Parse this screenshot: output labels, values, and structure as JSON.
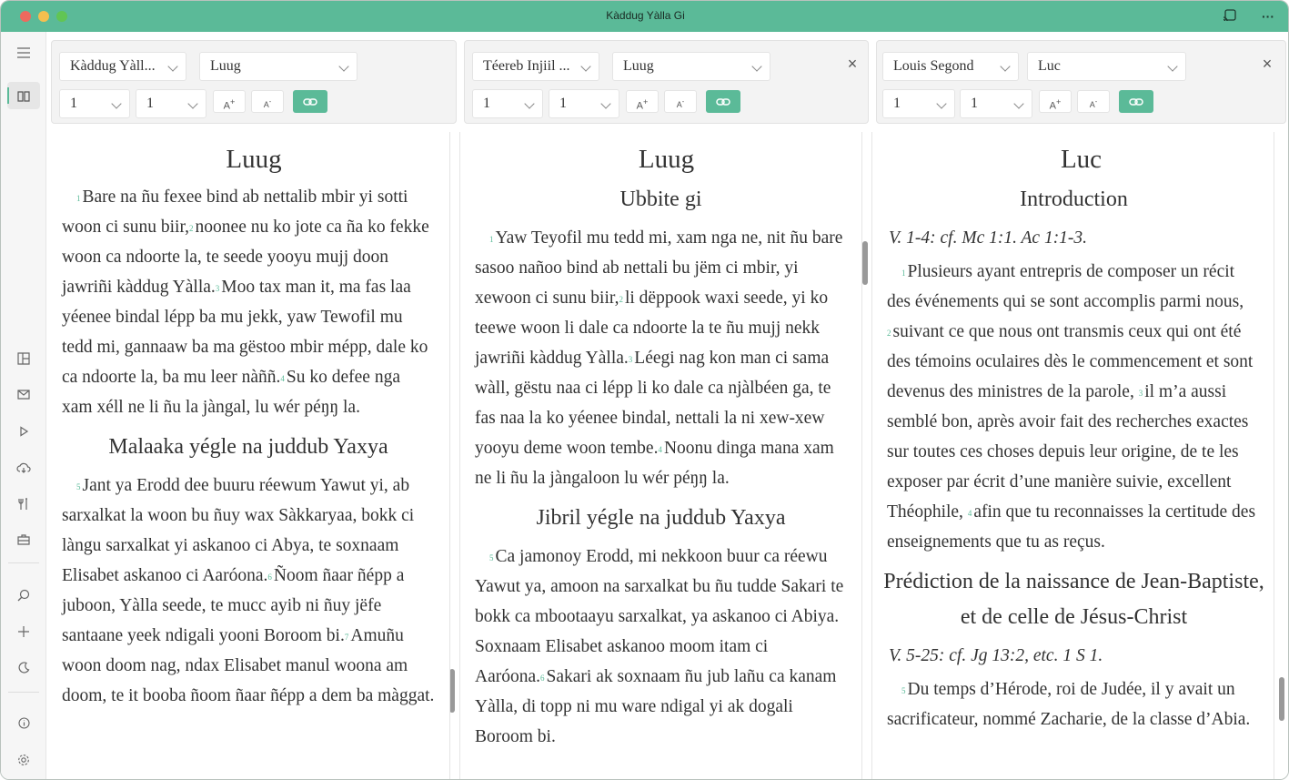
{
  "window": {
    "title": "Kàddug Yàlla Gi"
  },
  "colors": {
    "accent": "#5bba98",
    "titlebar": "#5bba98"
  },
  "sidebar": {
    "items": [
      {
        "name": "menu-icon"
      },
      {
        "name": "book-icon"
      },
      {
        "name": "compare-icon"
      },
      {
        "name": "mail-icon"
      },
      {
        "name": "play-icon"
      },
      {
        "name": "cloud-download-icon"
      },
      {
        "name": "tools-icon"
      },
      {
        "name": "briefcase-icon"
      },
      {
        "name": "search-icon"
      },
      {
        "name": "plus-icon"
      },
      {
        "name": "moon-icon"
      },
      {
        "name": "info-icon"
      },
      {
        "name": "settings-icon"
      }
    ]
  },
  "panes": [
    {
      "version": "Kàddug Yàll...",
      "book": "Luug",
      "chapter": "1",
      "verse": "1",
      "font_up": "A",
      "font_down": "A",
      "closable": false,
      "title": "Luug",
      "blocks": [
        {
          "type": "para",
          "segments": [
            {
              "v": "1",
              "t": "Bare na ñu fexee bind ab nettalib mbir yi sotti woon ci sunu biir,"
            },
            {
              "v": "2",
              "t": "noonee nu ko jote ca ña ko fekke woon ca ndoorte la, te seede yooyu mujj doon jawriñi kàddug Yàlla."
            },
            {
              "v": "3",
              "t": "Moo tax man it, ma fas laa yéenee bindal lépp ba mu jekk, yaw Tewofil mu tedd mi, gannaaw ba ma gëstoo mbir mépp, dale ko ca ndoorte la, ba mu leer nàññ."
            },
            {
              "v": "4",
              "t": "Su ko defee nga xam xéll ne li ñu la jàngal, lu wér péŋŋ la."
            }
          ]
        },
        {
          "type": "heading",
          "text": "Malaaka yégle na juddub Yaxya"
        },
        {
          "type": "para",
          "segments": [
            {
              "v": "5",
              "t": "Jant ya Erodd dee buuru réewum Yawut yi, ab sarxalkat la woon bu ñuy wax Sàkkaryaa, bokk ci làngu sarxalkat yi askanoo ci Abya, te soxnaam Elisabet askanoo ci Aaróona."
            },
            {
              "v": "6",
              "t": "Ñoom ñaar ñépp a juboon, Yàlla seede, te mucc ayib ni ñuy jëfe santaane yeek ndigali yooni Boroom bi."
            },
            {
              "v": "7",
              "t": "Amuñu woon doom nag, ndax Elisabet manul woona am doom, te it booba ñoom ñaar ñépp a dem ba màggat."
            }
          ]
        }
      ]
    },
    {
      "version": "Téereb Injiil ...",
      "book": "Luug",
      "chapter": "1",
      "verse": "1",
      "font_up": "A",
      "font_down": "A",
      "closable": true,
      "title": "Luug",
      "blocks": [
        {
          "type": "heading",
          "text": "Ubbite gi"
        },
        {
          "type": "para",
          "segments": [
            {
              "v": "1",
              "t": "Yaw Teyofil mu tedd mi, xam nga ne, nit ñu bare sasoo nañoo bind ab nettali bu jëm ci mbir, yi xewoon ci sunu biir,"
            },
            {
              "v": "2",
              "t": "li dëppook waxi seede, yi ko teewe woon li dale ca ndoorte la te ñu mujj nekk jawriñi kàddug Yàlla."
            },
            {
              "v": "3",
              "t": "Léegi nag kon man ci sama wàll, gëstu naa ci lépp li ko dale ca njàlbéen ga, te fas naa la ko yéenee bindal, nettali la ni xew-xew yooyu deme woon tembe."
            },
            {
              "v": "4",
              "t": "Noonu dinga mana xam ne li ñu la jàngaloon lu wér péŋŋ la."
            }
          ]
        },
        {
          "type": "heading",
          "text": "Jibril yégle na juddub Yaxya"
        },
        {
          "type": "para",
          "segments": [
            {
              "v": "5",
              "t": "Ca jamonoy Erodd, mi nekkoon buur ca réewu Yawut ya, amoon na sarxalkat bu ñu tudde Sakari te bokk ca mbootaayu sarxalkat, ya askanoo ci Abiya. Soxnaam Elisabet askanoo moom itam ci Aaróona."
            },
            {
              "v": "6",
              "t": "Sakari ak soxnaam ñu jub lañu ca kanam Yàlla, di topp ni mu ware ndigal yi ak dogali Boroom bi."
            }
          ]
        }
      ]
    },
    {
      "version": "Louis Segond",
      "book": "Luc",
      "chapter": "1",
      "verse": "1",
      "font_up": "A",
      "font_down": "A",
      "closable": true,
      "title": "Luc",
      "blocks": [
        {
          "type": "heading",
          "text": "Introduction"
        },
        {
          "type": "ref",
          "text": "V. 1-4: cf. Mc 1:1. Ac 1:1-3."
        },
        {
          "type": "para",
          "segments": [
            {
              "v": "1",
              "t": "Plusieurs ayant entrepris de composer un récit des événements qui se sont accomplis parmi nous, "
            },
            {
              "v": "2",
              "t": "suivant ce que nous ont transmis ceux qui ont été des témoins oculaires dès le commencement et sont devenus des ministres de la parole, "
            },
            {
              "v": "3",
              "t": "il m’a aussi semblé bon, après avoir fait des recherches exactes sur toutes ces choses depuis leur origine, de te les exposer par écrit d’une manière suivie, excellent Théophile, "
            },
            {
              "v": "4",
              "t": "afin que tu reconnaisses la certitude des enseignements que tu as reçus."
            }
          ]
        },
        {
          "type": "heading",
          "text": "Prédiction de la naissance de Jean-Baptiste, et de celle de Jésus-Christ"
        },
        {
          "type": "ref",
          "text": "V. 5-25: cf. Jg 13:2, etc. 1 S 1."
        },
        {
          "type": "para",
          "segments": [
            {
              "v": "5",
              "t": "Du temps d’Hérode, roi de Judée, il y avait un sacrificateur, nommé Zacharie, de la classe d’Abia."
            }
          ]
        }
      ]
    }
  ]
}
